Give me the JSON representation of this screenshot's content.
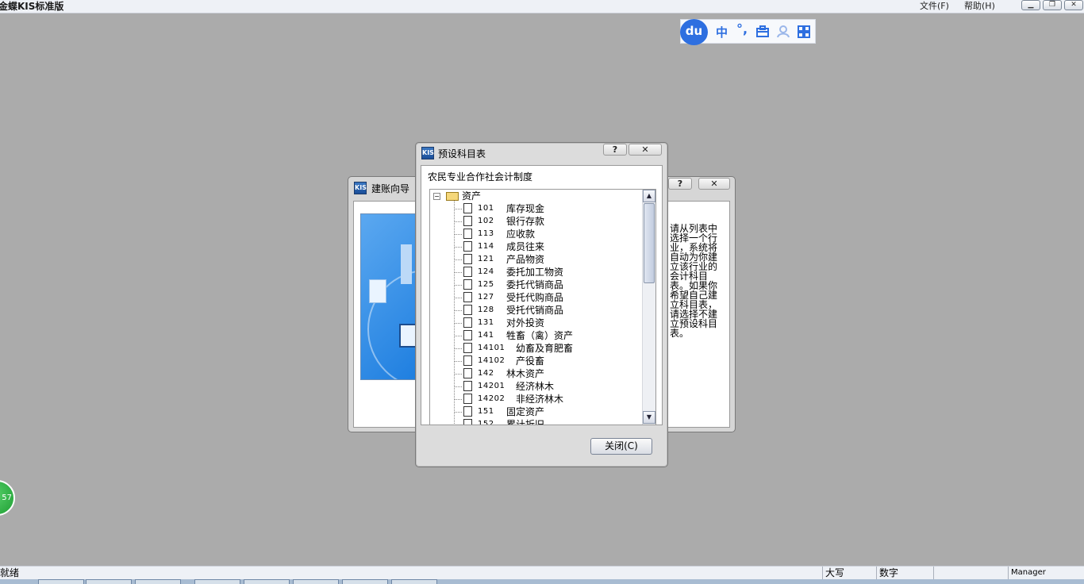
{
  "app": {
    "title": "金蝶KIS标准版",
    "menu": [
      "文件(F)",
      "帮助(H)"
    ],
    "window_buttons": [
      "minimize",
      "restore",
      "close"
    ]
  },
  "ime": {
    "logo": "du",
    "mode": "中",
    "punctuation": "°,",
    "icons": [
      "toolbox-icon",
      "user-icon",
      "grid-icon"
    ]
  },
  "wizard": {
    "title": "建账向导",
    "help_label": "?",
    "close_label": "✕",
    "description": "请从列表中选择一个行业，系统将自动为你建立该行业的会计科目表。如果你希望自己建立科目表，请选择不建立预设科目表。"
  },
  "dialog": {
    "title": "预设科目表",
    "help_label": "?",
    "close_label": "✕",
    "system_name": "农民专业合作社会计制度",
    "root_label": "资产",
    "accounts": [
      {
        "code": "101",
        "name": "库存现金"
      },
      {
        "code": "102",
        "name": "银行存款"
      },
      {
        "code": "113",
        "name": "应收款"
      },
      {
        "code": "114",
        "name": "成员往来"
      },
      {
        "code": "121",
        "name": "产品物资"
      },
      {
        "code": "124",
        "name": "委托加工物资"
      },
      {
        "code": "125",
        "name": "委托代销商品"
      },
      {
        "code": "127",
        "name": "受托代购商品"
      },
      {
        "code": "128",
        "name": "受托代销商品"
      },
      {
        "code": "131",
        "name": "对外投资"
      },
      {
        "code": "141",
        "name": "牲畜（禽）资产"
      },
      {
        "code": "14101",
        "name": "幼畜及育肥畜"
      },
      {
        "code": "14102",
        "name": "产役畜"
      },
      {
        "code": "142",
        "name": "林木资产"
      },
      {
        "code": "14201",
        "name": "经济林木"
      },
      {
        "code": "14202",
        "name": "非经济林木"
      },
      {
        "code": "151",
        "name": "固定资产"
      },
      {
        "code": "152",
        "name": "累计折旧"
      }
    ],
    "close_button": "关闭(C)"
  },
  "badge": {
    "value": "57"
  },
  "status": {
    "ready": "就绪",
    "caps": "大写",
    "num": "数字",
    "user": "Manager"
  }
}
